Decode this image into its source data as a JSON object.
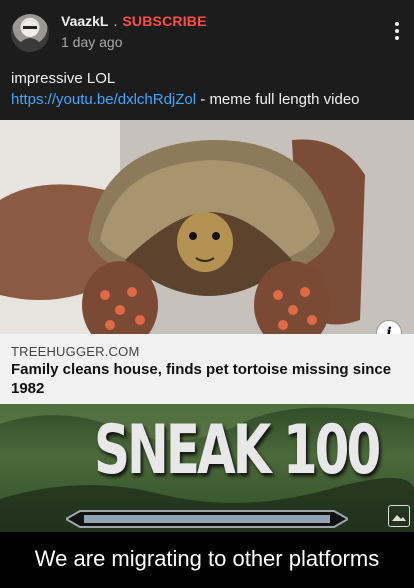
{
  "post": {
    "author": "VaazkL",
    "separator": ".",
    "subscribe_label": "SUBSCRIBE",
    "time": "1 day ago",
    "body_line1": "impressive LOL",
    "link_text": "https://youtu.be/dxlchRdjZol",
    "body_line2_suffix": " - meme full length video"
  },
  "link_card": {
    "site": "TREEHUGGER.COM",
    "title": "Family cleans house, finds pet tortoise missing since 1982",
    "info_icon": "i"
  },
  "meme": {
    "text": "SNEAK 100"
  },
  "caption": {
    "text": "We are migrating to other platforms"
  },
  "colors": {
    "background": "#1c1c1c",
    "subscribe": "#ff4e45",
    "link": "#3ea6ff",
    "card_background": "#f2f2f2"
  },
  "icons": [
    "avatar",
    "more-options-icon",
    "info-icon",
    "image-icon"
  ]
}
